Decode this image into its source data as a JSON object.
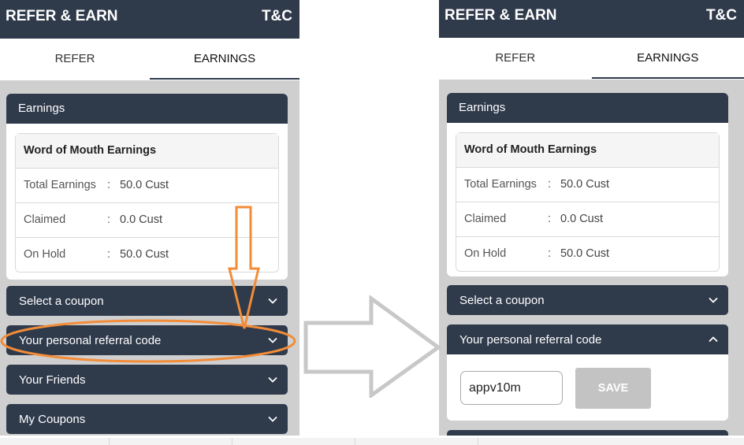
{
  "header": {
    "title": "REFER & EARN",
    "tc": "T&C"
  },
  "tabs": {
    "refer": "REFER",
    "earnings": "EARNINGS"
  },
  "earnings": {
    "section_title": "Earnings",
    "table_title": "Word of Mouth Earnings",
    "rows": [
      {
        "label": "Total Earnings",
        "sep": ":",
        "value": "50.0 Cust"
      },
      {
        "label": "Claimed",
        "sep": ":",
        "value": "0.0 Cust"
      },
      {
        "label": "On Hold",
        "sep": ":",
        "value": "50.0 Cust"
      }
    ]
  },
  "accordion": {
    "coupon": "Select a coupon",
    "referral": "Your personal referral code",
    "friends": "Your Friends",
    "my_coupons": "My Coupons"
  },
  "referral": {
    "code": "appv10m",
    "save": "SAVE"
  },
  "colors": {
    "dark": "#2f3a4b",
    "highlight": "#f28c38",
    "arrow": "#c8c8c8"
  }
}
